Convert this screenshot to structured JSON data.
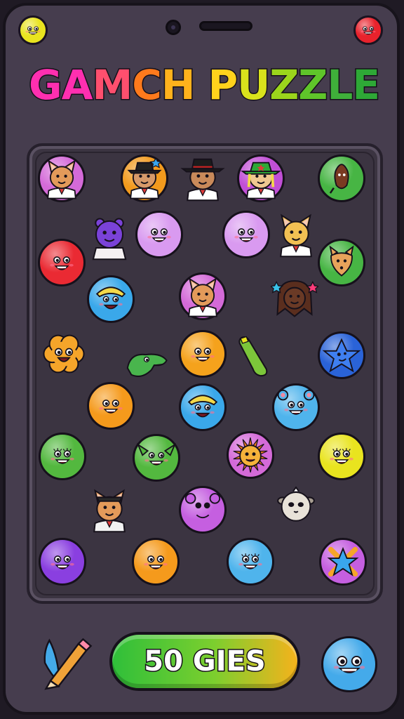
{
  "title": {
    "text": "GAMCH PUZZLE",
    "letters": [
      {
        "ch": "G",
        "color": "#ff2fb0"
      },
      {
        "ch": "A",
        "color": "#ff2fb0"
      },
      {
        "ch": "M",
        "color": "#ff4f6e"
      },
      {
        "ch": "C",
        "color": "#ff7a1c"
      },
      {
        "ch": "H",
        "color": "#ffb21c"
      },
      {
        "ch": " ",
        "color": "#ffffff"
      },
      {
        "ch": "P",
        "color": "#ffd21c"
      },
      {
        "ch": "U",
        "color": "#d9e21c"
      },
      {
        "ch": "Z",
        "color": "#9bd51c"
      },
      {
        "ch": "Z",
        "color": "#5fc52a"
      },
      {
        "ch": "L",
        "color": "#3fb03a"
      },
      {
        "ch": "E",
        "color": "#2ea836"
      }
    ]
  },
  "moves_button": {
    "label": "50 GIES"
  },
  "colors": {
    "frame": "#463d4e",
    "board": "#3b3441",
    "button_start": "#2fbf3a",
    "button_end": "#f5b21c"
  },
  "corner_icons": [
    {
      "name": "yellow-smiley-icon",
      "color": "#e9e41f"
    },
    {
      "name": "red-smiley-icon",
      "color": "#e8222c"
    }
  ],
  "pieces": [
    {
      "name": "fox-character-icon",
      "kind": "fox",
      "color": "#d46ad8",
      "fur": "#e39a5a",
      "row": 0,
      "col": 0
    },
    {
      "name": "cowboy-character-icon",
      "kind": "hat",
      "color": "#f29a1d",
      "fur": "#d79a6a",
      "row": 0,
      "col": 1
    },
    {
      "name": "black-hat-character-icon",
      "kind": "hatnb",
      "color": "none",
      "fur": "#c98a5a",
      "row": 0,
      "col": 2
    },
    {
      "name": "green-hat-character-icon",
      "kind": "hatg",
      "color": "#c14fd6",
      "fur": "#f0c890",
      "row": 0,
      "col": 3
    },
    {
      "name": "brown-creature-icon",
      "kind": "blob",
      "color": "#47b544",
      "fur": "#7a3a22",
      "row": 0,
      "col": 4
    },
    {
      "name": "purple-bear-icon",
      "kind": "bear",
      "color": "none",
      "fur": "#7a42d8",
      "row": 1,
      "col": 1
    },
    {
      "name": "pink-smiley-icon",
      "kind": "smile",
      "color": "#d99af0",
      "row": 1,
      "col": 2
    },
    {
      "name": "pink-smiley-icon",
      "kind": "smile",
      "color": "#d99af0",
      "row": 1,
      "col": 3
    },
    {
      "name": "cat-character-icon",
      "kind": "cat",
      "color": "none",
      "fur": "#f2c053",
      "row": 1,
      "col": 4
    },
    {
      "name": "red-smiley-icon",
      "kind": "smile",
      "color": "#ea2a33",
      "row": 1,
      "col": 0
    },
    {
      "name": "fox-face-icon",
      "kind": "foxface",
      "color": "#47b544",
      "fur": "#e8a35b",
      "row": 1,
      "col": 5
    },
    {
      "name": "blue-blonde-smiley-icon",
      "kind": "blonde",
      "color": "#3aa8ea",
      "row": 2,
      "col": 1
    },
    {
      "name": "fox-character-icon",
      "kind": "fox",
      "color": "#d46ad8",
      "fur": "#e39a5a",
      "row": 2,
      "col": 3
    },
    {
      "name": "brown-dreadlock-character-icon",
      "kind": "dread",
      "color": "none",
      "fur": "#6a3a26",
      "row": 2,
      "col": 4
    },
    {
      "name": "orange-flower-smiley-icon",
      "kind": "flower",
      "color": "#f5a52a",
      "row": 3,
      "col": 0
    },
    {
      "name": "green-dino-icon",
      "kind": "dino",
      "color": "none",
      "fur": "#49b54d",
      "row": 3,
      "col": 1
    },
    {
      "name": "orange-smiley-icon",
      "kind": "smile",
      "color": "#f5a21c",
      "row": 3,
      "col": 2
    },
    {
      "name": "green-cucumber-icon",
      "kind": "cucumber",
      "color": "none",
      "fur": "#7cc63a",
      "row": 3,
      "col": 3
    },
    {
      "name": "blue-star-blob-icon",
      "kind": "bluestar",
      "color": "#2a63d8",
      "row": 3,
      "col": 4
    },
    {
      "name": "orange-smiley-icon",
      "kind": "smile",
      "color": "#f59a1c",
      "row": 4,
      "col": 1
    },
    {
      "name": "blue-blonde-smiley-icon",
      "kind": "blonde",
      "color": "#3aa8ea",
      "row": 4,
      "col": 2
    },
    {
      "name": "blue-bear-icon",
      "kind": "bluebear",
      "color": "#4fb4ec",
      "row": 4,
      "col": 4
    },
    {
      "name": "green-smiley-icon",
      "kind": "smilelash",
      "color": "#53b83f",
      "row": 5,
      "col": 0
    },
    {
      "name": "green-goblin-icon",
      "kind": "goblin",
      "color": "#53b83f",
      "row": 5,
      "col": 1
    },
    {
      "name": "lion-icon",
      "kind": "lion",
      "color": "#d46ad8",
      "fur": "#f5a52a",
      "row": 5,
      "col": 3
    },
    {
      "name": "yellow-smiley-icon",
      "kind": "smilelash",
      "color": "#e9e41f",
      "row": 5,
      "col": 4
    },
    {
      "name": "fox-suit-character-icon",
      "kind": "foxsuit",
      "color": "none",
      "fur": "#e39a5a",
      "row": 6,
      "col": 1
    },
    {
      "name": "purple-bear-smiley-icon",
      "kind": "purplebear",
      "color": "#c55fe0",
      "row": 6,
      "col": 2
    },
    {
      "name": "white-sheep-icon",
      "kind": "sheep",
      "color": "none",
      "fur": "#e8e2d8",
      "row": 6,
      "col": 4
    },
    {
      "name": "purple-smiley-icon",
      "kind": "smile",
      "color": "#8a3fe0",
      "row": 7,
      "col": 0
    },
    {
      "name": "orange-smiley-icon",
      "kind": "smile",
      "color": "#f59a1c",
      "row": 7,
      "col": 1
    },
    {
      "name": "blue-smiley-icon",
      "kind": "smilelash",
      "color": "#4fb4ec",
      "row": 7,
      "col": 3
    },
    {
      "name": "star-icon",
      "kind": "star",
      "color": "#c55fe0",
      "row": 7,
      "col": 4
    }
  ],
  "tools": [
    {
      "name": "pencil-icon",
      "color": "#f0a238"
    },
    {
      "name": "blue-smiley-icon",
      "color": "#44aaea"
    }
  ]
}
